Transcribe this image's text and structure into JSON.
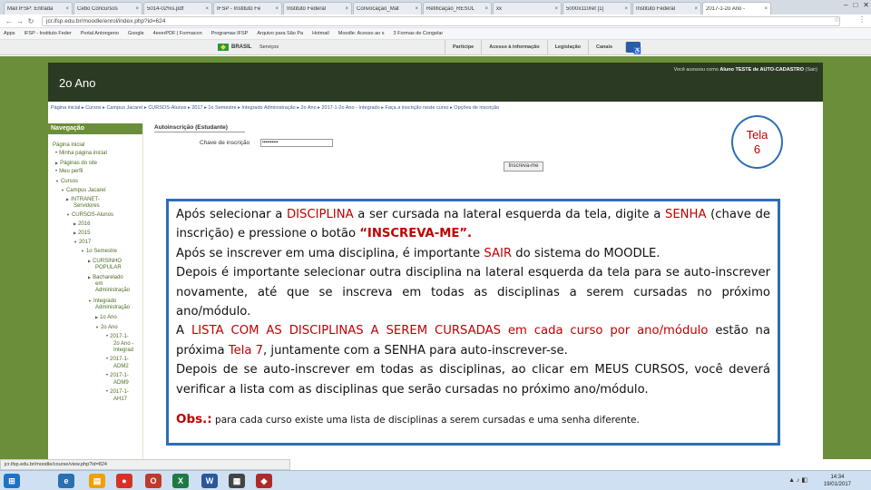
{
  "browser": {
    "tabs": [
      {
        "label": "Mail IFSP: Entrada"
      },
      {
        "label": "Cebo Concursos"
      },
      {
        "label": "5014-02%s.pdf"
      },
      {
        "label": "IFSP - Instituto Fe"
      },
      {
        "label": "Instituto Federal"
      },
      {
        "label": "Convocação_Mat"
      },
      {
        "label": "Retificação_RESUL"
      },
      {
        "label": "xx"
      },
      {
        "label": "5000x110ret [1]"
      },
      {
        "label": "Instituto Federal"
      },
      {
        "label": "2017-1-2o Ano -",
        "active": true
      }
    ],
    "url": "jcr.ifsp.edu.br/moodle/enrol/index.php?id=624",
    "bookmarks": [
      "Apps",
      "IFSP - Instituto Feder",
      "Portal Antongeno",
      "Google",
      "4everPDF | Formacon",
      "Programas IFSP",
      "Arquivo para São Pa",
      "Hotmail",
      "Moodle: Acesso ao s",
      "3 Formas de Congelar"
    ]
  },
  "govbar": {
    "brasil": "BRASIL",
    "servicos": "Serviços",
    "links": [
      "Participe",
      "Acesso à informação",
      "Legislação",
      "Canais"
    ]
  },
  "moodle": {
    "course_title": "2o Ano",
    "login_prefix": "Você acessou como",
    "login_user": "Aluno TESTE de AUTO-CADASTRO",
    "login_logout": "(Sair)",
    "breadcrumb": "Página inicial  ▸  Cursos  ▸  Campus Jacareí  ▸  CURSOS-Alunos  ▸  2017  ▸  1o Semestre  ▸  Integrado Administração  ▸  2o Ano  ▸  2017-1-2o Ano - Integrado  ▸  Faça a inscrição neste curso  ▸  Opções de inscrição",
    "nav": {
      "title": "Navegação",
      "items": [
        "Página inicial",
        "Minha página inicial",
        "Páginas do site",
        "Meu perfil",
        "Cursos",
        "Campus Jacareí",
        "INTRANET-",
        "Servidores",
        "CURSOS-Alunos",
        "2016",
        "2015",
        "2017",
        "1o Semestre",
        "CURSINHO",
        "POPULAR",
        "Bacharelado",
        "em",
        "Administração",
        "Integrado",
        "Administração",
        "1o Ano",
        "2o Ano",
        "2017-1-",
        "2o Ano -",
        "Integrad",
        "2017-1-",
        "ADM2",
        "2017-1-",
        "ADM9",
        "2017-1-",
        "AH17"
      ]
    },
    "selfenrol": {
      "legend": "Autoinscrição (Estudante)",
      "key_label": "Chave de inscrição",
      "key_value": "••••••••••",
      "button": "Inscreva-me"
    }
  },
  "bubble": {
    "line1": "Tela",
    "line2": "6"
  },
  "instructions": {
    "p1_a": "Após selecionar a ",
    "p1_b": "DISCIPLINA",
    "p1_c": " a ser cursada na lateral esquerda da tela, digite a ",
    "p1_d": "SENHA",
    "p1_e": " (chave de inscrição)  e pressione o botão ",
    "p1_f": "“INSCREVA-ME”.",
    "p2_a": "Após se inscrever em uma disciplina, é importante ",
    "p2_b": "SAIR",
    "p2_c": " do sistema do MOODLE.",
    "p3": "Depois é importante selecionar outra disciplina na lateral esquerda da tela para se auto-inscrever novamente, até que se inscreva em todas as disciplinas a serem cursadas no próximo ano/módulo.",
    "p4_a": "A ",
    "p4_b": "LISTA COM AS DISCIPLINAS A SEREM CURSADAS em cada curso por ano/módulo",
    "p4_c": " estão na próxima ",
    "p4_d": "Tela 7",
    "p4_e": ", juntamente com a SENHA para auto-inscrever-se.",
    "p5": "Depois de se auto-inscrever em todas as disciplinas, ao clicar em MEUS CURSOS, você deverá verificar a lista com as disciplinas que serão cursadas no próximo ano/módulo.",
    "obs_label": "Obs.:",
    "obs_text": " para cada curso existe uma lista de disciplinas a serem cursadas e uma senha diferente."
  },
  "statusbar": "jcr.ifsp.edu.br/moodle/course/view.php?id=824",
  "taskbar": {
    "time": "14:34",
    "date": "19/01/2017"
  }
}
